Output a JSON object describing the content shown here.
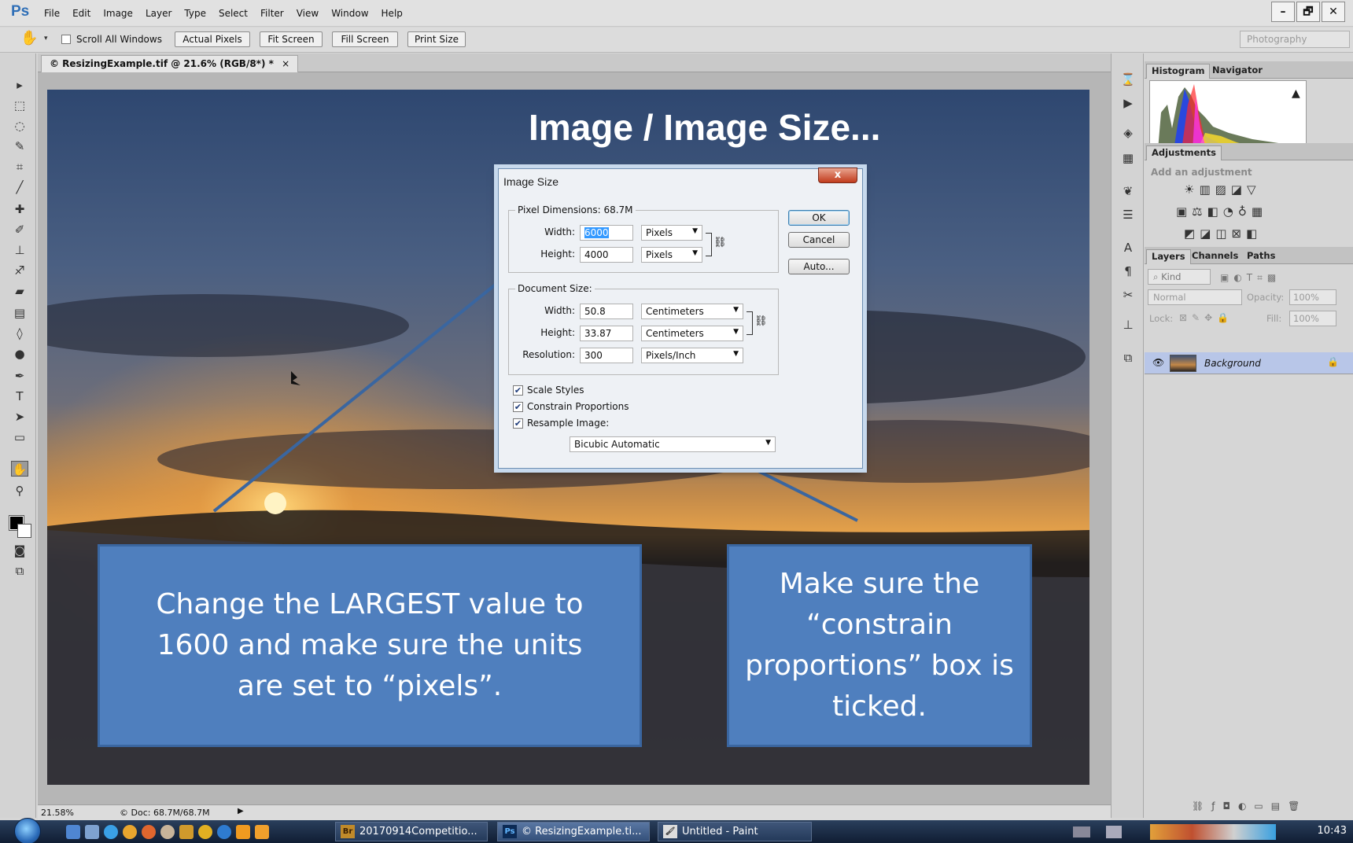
{
  "app": {
    "logo": "Ps"
  },
  "menu": [
    "File",
    "Edit",
    "Image",
    "Layer",
    "Type",
    "Select",
    "Filter",
    "View",
    "Window",
    "Help"
  ],
  "window_controls": [
    "–",
    "🗗",
    "✕"
  ],
  "options_bar": {
    "scroll_all_windows": "Scroll All Windows",
    "buttons": [
      "Actual Pixels",
      "Fit Screen",
      "Fill Screen",
      "Print Size"
    ],
    "workspace": "Photography"
  },
  "document": {
    "tab_title": "© ResizingExample.tif @ 21.6% (RGB/8*) *",
    "tab_close": "×",
    "zoom": "21.58%",
    "doc_info": "© Doc: 68.7M/68.7M"
  },
  "overlay_title": "Image / Image Size...",
  "dialog": {
    "title": "Image Size",
    "close": "x",
    "pixel_dimensions": {
      "legend": "Pixel Dimensions:  68.7M",
      "width_label": "Width:",
      "width_value": "6000",
      "width_unit": "Pixels",
      "height_label": "Height:",
      "height_value": "4000",
      "height_unit": "Pixels"
    },
    "document_size": {
      "legend": "Document Size:",
      "width_label": "Width:",
      "width_value": "50.8",
      "width_unit": "Centimeters",
      "height_label": "Height:",
      "height_value": "33.87",
      "height_unit": "Centimeters",
      "resolution_label": "Resolution:",
      "resolution_value": "300",
      "resolution_unit": "Pixels/Inch"
    },
    "checkboxes": {
      "scale_styles": {
        "label": "Scale Styles",
        "checked": true
      },
      "constrain_proportions": {
        "label": "Constrain Proportions",
        "checked": true
      },
      "resample_image": {
        "label": "Resample Image:",
        "checked": true
      }
    },
    "resample_method": "Bicubic Automatic",
    "buttons": {
      "ok": "OK",
      "cancel": "Cancel",
      "auto": "Auto..."
    }
  },
  "callouts": {
    "left": "Change the LARGEST value to 1600 and make sure the units are set to “pixels”.",
    "right": "Make sure the “constrain proportions” box is ticked."
  },
  "panels": {
    "histogram_tabs": [
      "Histogram",
      "Navigator"
    ],
    "adjustments_tab": "Adjustments",
    "adjustments_hint": "Add an adjustment",
    "layers_tabs": [
      "Layers",
      "Channels",
      "Paths"
    ],
    "kind": "Kind",
    "blend_mode": "Normal",
    "opacity_label": "Opacity:",
    "opacity_value": "100%",
    "lock_label": "Lock:",
    "fill_label": "Fill:",
    "fill_value": "100%",
    "layer_name": "Background"
  },
  "taskbar": {
    "tasks": [
      "20170914Competitio...",
      "© ResizingExample.ti...",
      "Untitled - Paint"
    ],
    "clock": "10:43"
  }
}
